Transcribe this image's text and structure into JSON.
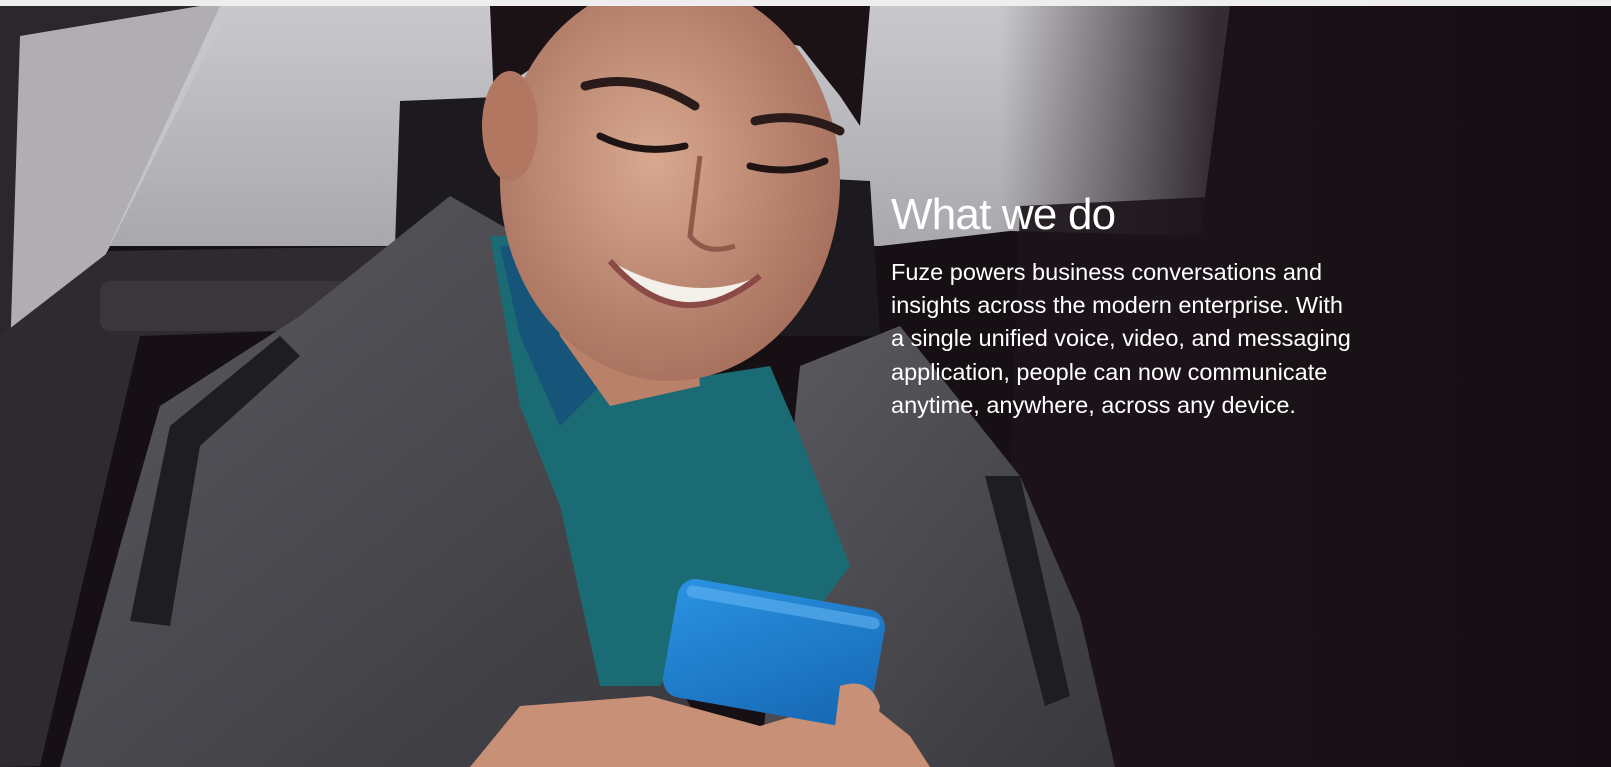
{
  "hero": {
    "title": "What we do",
    "body": "Fuze powers business conversations and insights across the modern enterprise. With a single unified voice, video, and messaging application, people can now communicate anytime, anywhere, across any device.",
    "photo_alt": "Woman in a car smiling while looking at a blue smartphone"
  },
  "colors": {
    "background": "#140d12",
    "text": "#ffffff",
    "phone": "#1f7fd0",
    "scarf": "#1a6b73",
    "coat": "#4b4a4f"
  }
}
